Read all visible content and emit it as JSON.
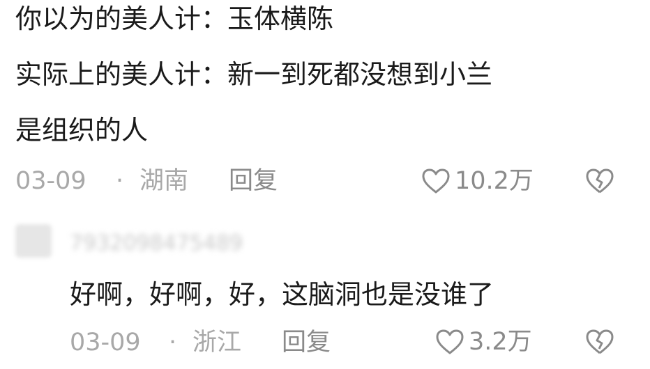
{
  "comment1": {
    "line1": "你以为的美人计：玉体横陈",
    "line2": "实际上的美人计：新一到死都没想到小兰",
    "line3": "是组织的人",
    "date": "03-09",
    "dot": "·",
    "location": "湖南",
    "reply_label": "回复",
    "likes": "10.2万"
  },
  "comment2": {
    "username": "7932098475489",
    "text": "好啊，好啊，好，这脑洞也是没谁了",
    "date": "03-09",
    "dot": "·",
    "location": "浙江",
    "reply_label": "回复",
    "likes": "3.2万"
  },
  "icons": {
    "like": "heart-outline-icon",
    "dislike": "broken-heart-icon"
  }
}
